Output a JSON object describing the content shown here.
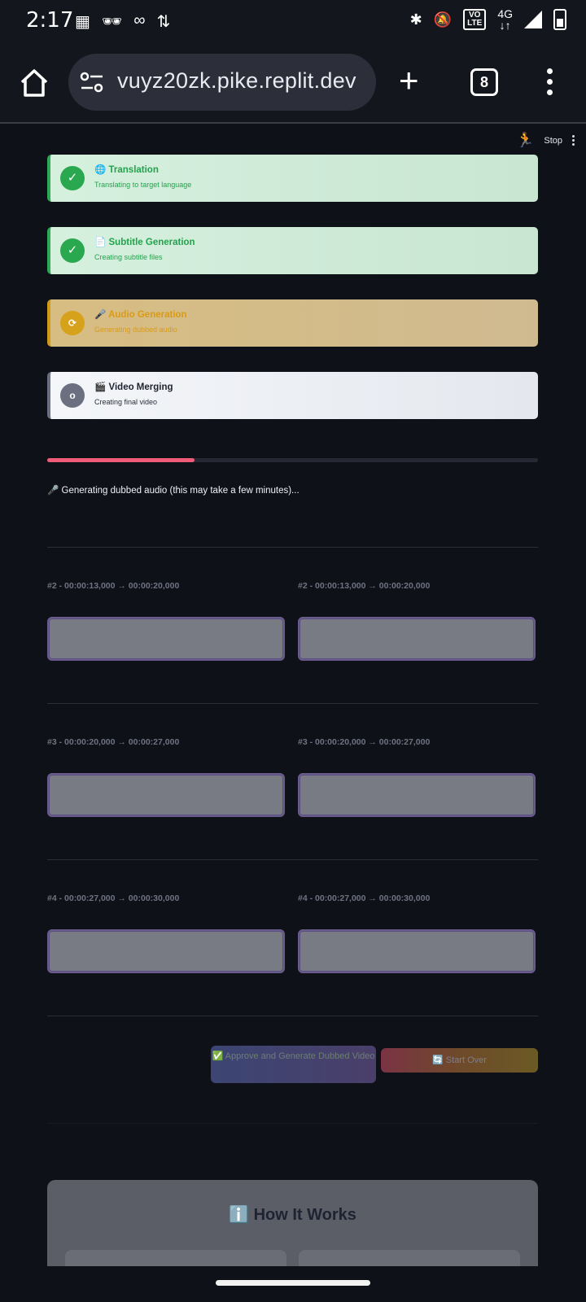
{
  "status_bar": {
    "time": "2:17",
    "left_icons": [
      "photo-icon",
      "incognito-icon",
      "mask-icon",
      "data-arrows-icon"
    ],
    "volte": "VO\nLTE",
    "network": "4G"
  },
  "browser": {
    "url": "vuyz20zk.pike.replit.dev",
    "tab_count": "8"
  },
  "page": {
    "stop_label": "Stop",
    "steps": [
      {
        "title": "🌐 Translation",
        "subtitle": "Translating to target language",
        "state": "done",
        "icon": "✓"
      },
      {
        "title": "📄 Subtitle Generation",
        "subtitle": "Creating subtitle files",
        "state": "done",
        "icon": "✓"
      },
      {
        "title": "🎤 Audio Generation",
        "subtitle": "Generating dubbed audio",
        "state": "running",
        "icon": "⟳"
      },
      {
        "title": "🎬 Video Merging",
        "subtitle": "Creating final video",
        "state": "pending",
        "icon": "o"
      }
    ],
    "progress": 0.3,
    "status_text": "🎤 Generating dubbed audio (this may take a few minutes)...",
    "segments": [
      {
        "left_label": "#2 - 00:00:13,000 → 00:00:20,000",
        "right_label": "#2 - 00:00:13,000 → 00:00:20,000"
      },
      {
        "left_label": "#3 - 00:00:20,000 → 00:00:27,000",
        "right_label": "#3 - 00:00:20,000 → 00:00:27,000"
      },
      {
        "left_label": "#4 - 00:00:27,000 → 00:00:30,000",
        "right_label": "#4 - 00:00:27,000 → 00:00:30,000"
      }
    ],
    "approve_button": "✅ Approve and Generate Dubbed Video",
    "start_over_button": "🔄 Start Over",
    "how_it_works_title": "ℹ️ How It Works"
  },
  "colors": {
    "done_accent": "#2aa84f",
    "running_accent": "#d7a21b",
    "pending_accent": "#6b7080",
    "progress": "#ef5c78"
  }
}
